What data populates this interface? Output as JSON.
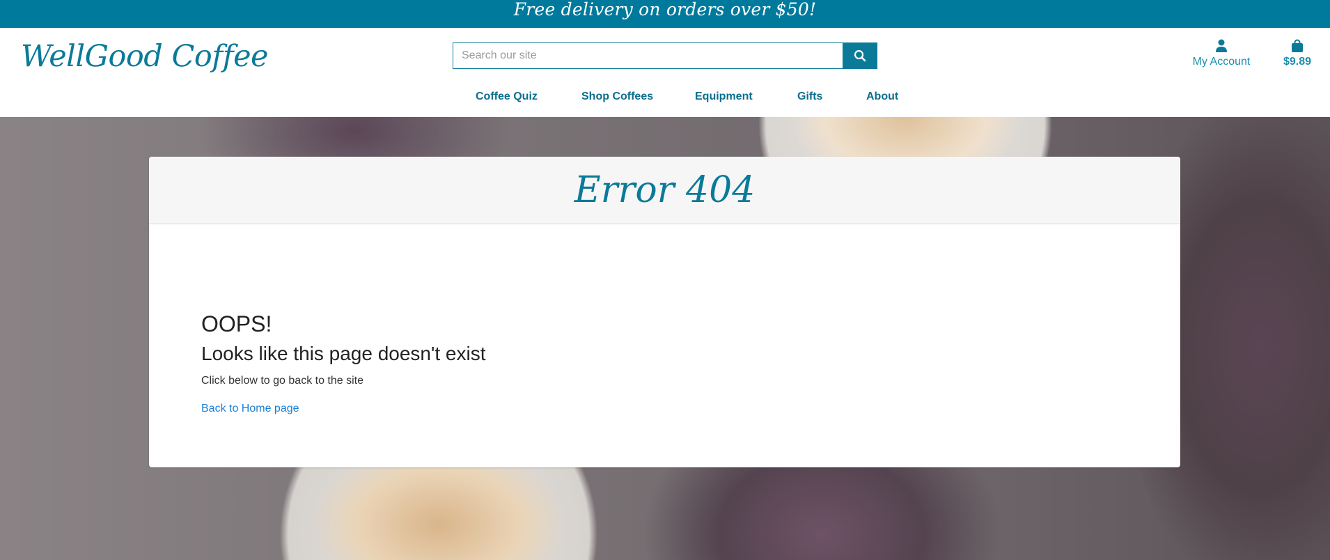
{
  "banner": {
    "text": "Free delivery on orders over $50!"
  },
  "header": {
    "logo": "WellGood Coffee",
    "search": {
      "placeholder": "Search our site",
      "value": ""
    },
    "account_label": "My Account",
    "cart_total": "$9.89"
  },
  "nav": {
    "items": [
      {
        "label": "Coffee Quiz"
      },
      {
        "label": "Shop Coffees"
      },
      {
        "label": "Equipment"
      },
      {
        "label": "Gifts"
      },
      {
        "label": "About"
      }
    ]
  },
  "error_card": {
    "title": "Error 404",
    "heading": "OOPS!",
    "subheading": "Looks like this page doesn't exist",
    "hint": "Click below to go back to the site",
    "link": "Back to Home page"
  },
  "colors": {
    "brand": "#007a9c",
    "link": "#1a7fd6",
    "card_header_bg": "#f6f6f6"
  },
  "icons": {
    "search": "search-icon",
    "account": "user-icon",
    "cart": "shopping-bag-icon"
  }
}
